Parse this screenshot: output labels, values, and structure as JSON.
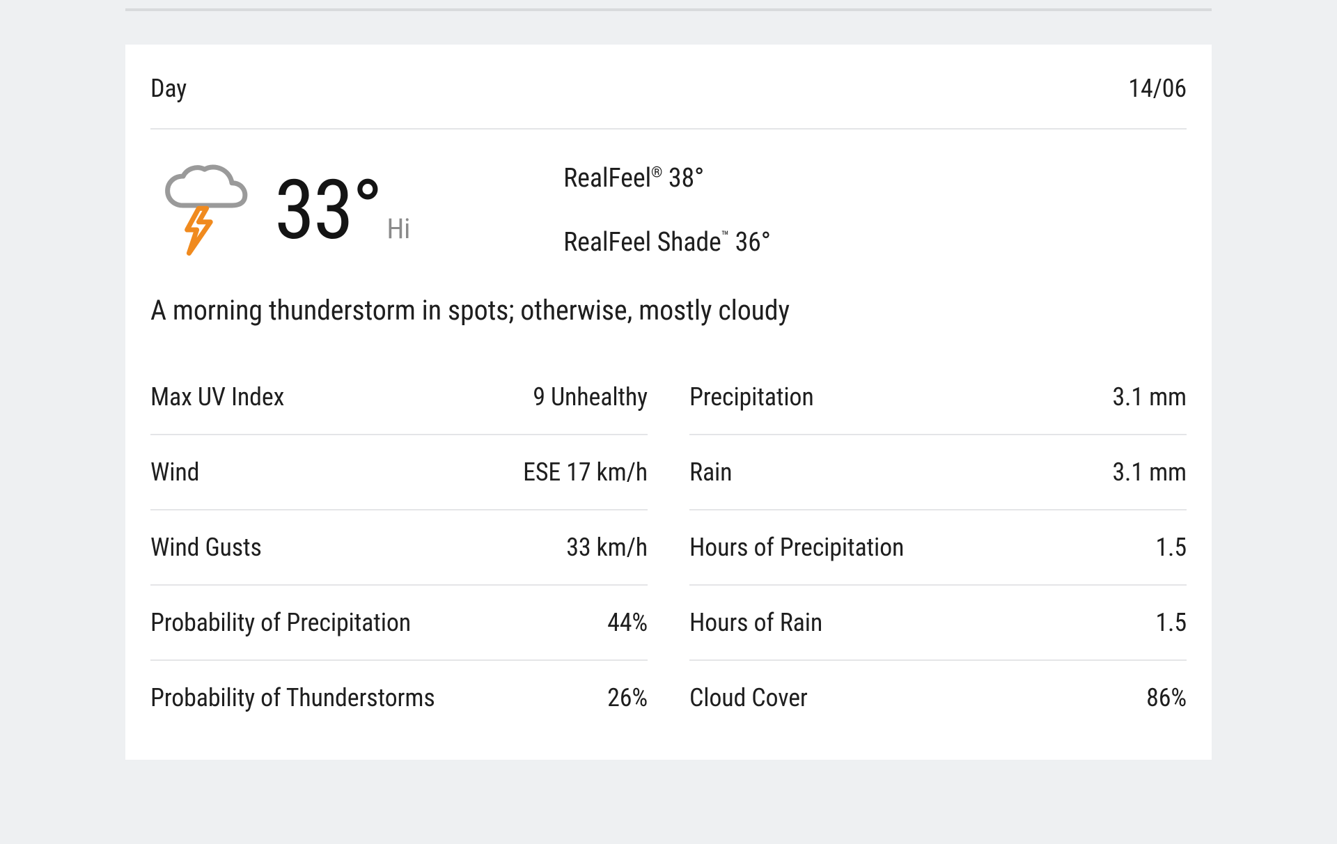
{
  "header": {
    "title": "Day",
    "date": "14/06"
  },
  "hero": {
    "temp": "33°",
    "hi_label": "Hi",
    "realfeel_label": "RealFeel",
    "realfeel_value": "38°",
    "realfeel_shade_label": "RealFeel Shade",
    "realfeel_shade_value": "36°"
  },
  "summary": "A morning thunderstorm in spots; otherwise, mostly cloudy",
  "details_left": [
    {
      "label": "Max UV Index",
      "value": "9 Unhealthy"
    },
    {
      "label": "Wind",
      "value": "ESE 17 km/h"
    },
    {
      "label": "Wind Gusts",
      "value": "33 km/h"
    },
    {
      "label": "Probability of Precipitation",
      "value": "44%"
    },
    {
      "label": "Probability of Thunderstorms",
      "value": "26%"
    }
  ],
  "details_right": [
    {
      "label": "Precipitation",
      "value": "3.1 mm"
    },
    {
      "label": "Rain",
      "value": "3.1 mm"
    },
    {
      "label": "Hours of Precipitation",
      "value": "1.5"
    },
    {
      "label": "Hours of Rain",
      "value": "1.5"
    },
    {
      "label": "Cloud Cover",
      "value": "86%"
    }
  ]
}
